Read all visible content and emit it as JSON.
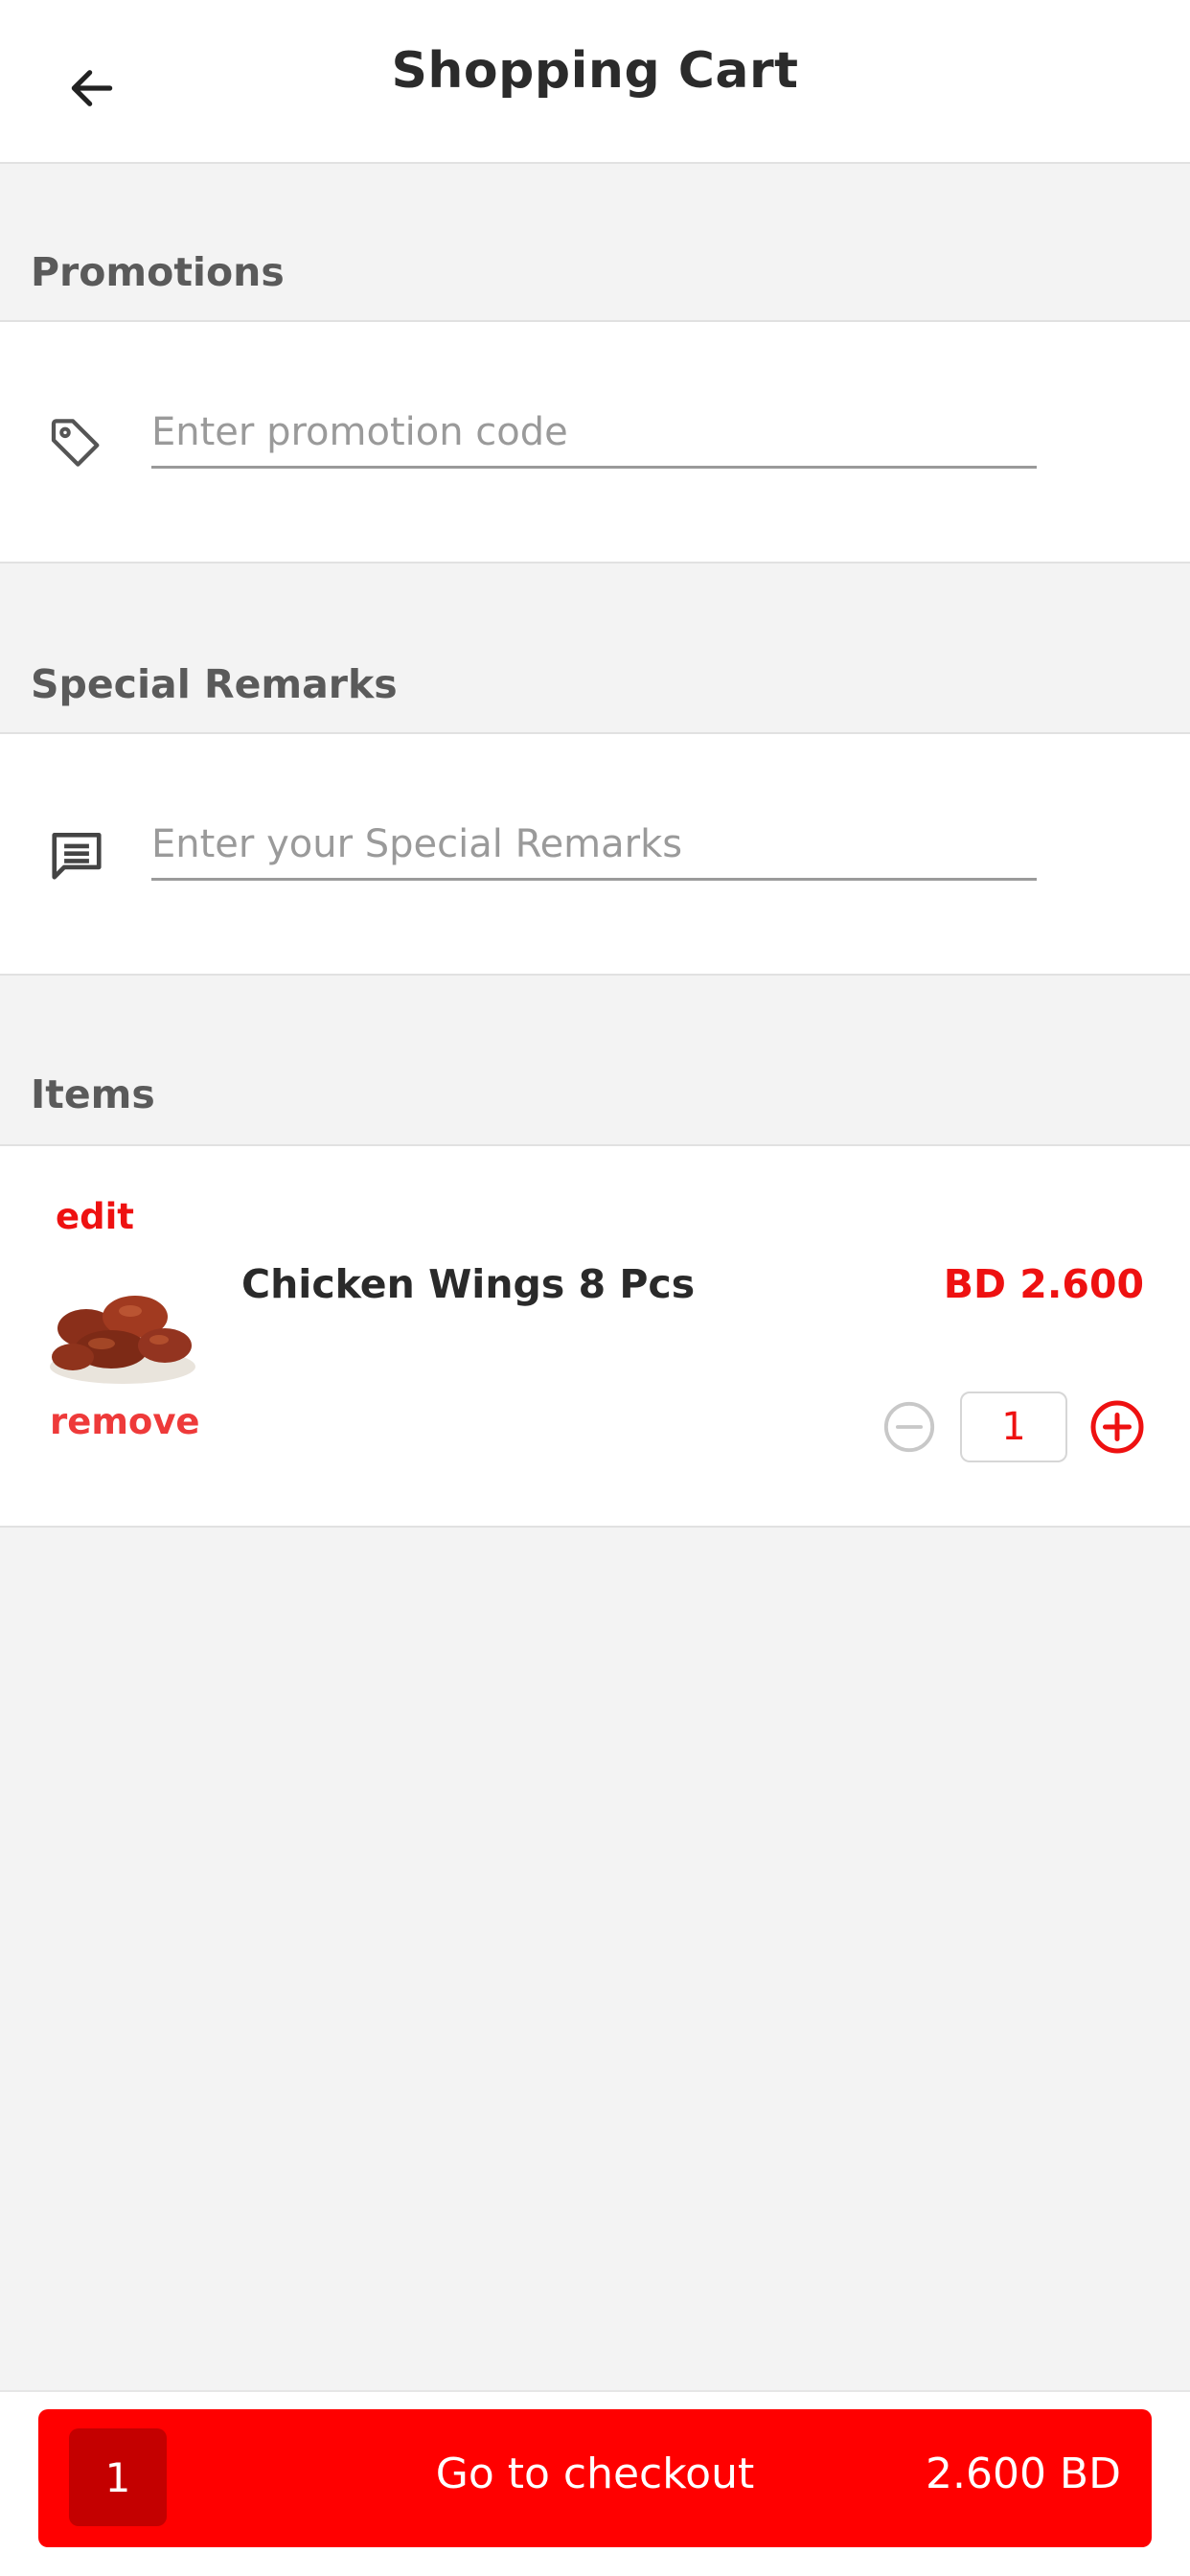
{
  "header": {
    "title": "Shopping Cart",
    "back_icon": "arrow-left-icon"
  },
  "promotions": {
    "label": "Promotions",
    "icon": "tag-icon",
    "placeholder": "Enter promotion code",
    "value": ""
  },
  "remarks": {
    "label": "Special Remarks",
    "icon": "comment-icon",
    "placeholder": "Enter your Special Remarks",
    "value": ""
  },
  "items_section": {
    "label": "Items",
    "items": [
      {
        "edit_label": "edit",
        "remove_label": "remove",
        "name": "Chicken Wings 8 Pcs",
        "price": "BD 2.600",
        "quantity": "1"
      }
    ]
  },
  "checkout": {
    "count": "1",
    "label": "Go to checkout",
    "total": "2.600 BD"
  },
  "colors": {
    "accent": "#ff0000",
    "accent_dark": "#c40000",
    "background": "#f3f3f3"
  }
}
